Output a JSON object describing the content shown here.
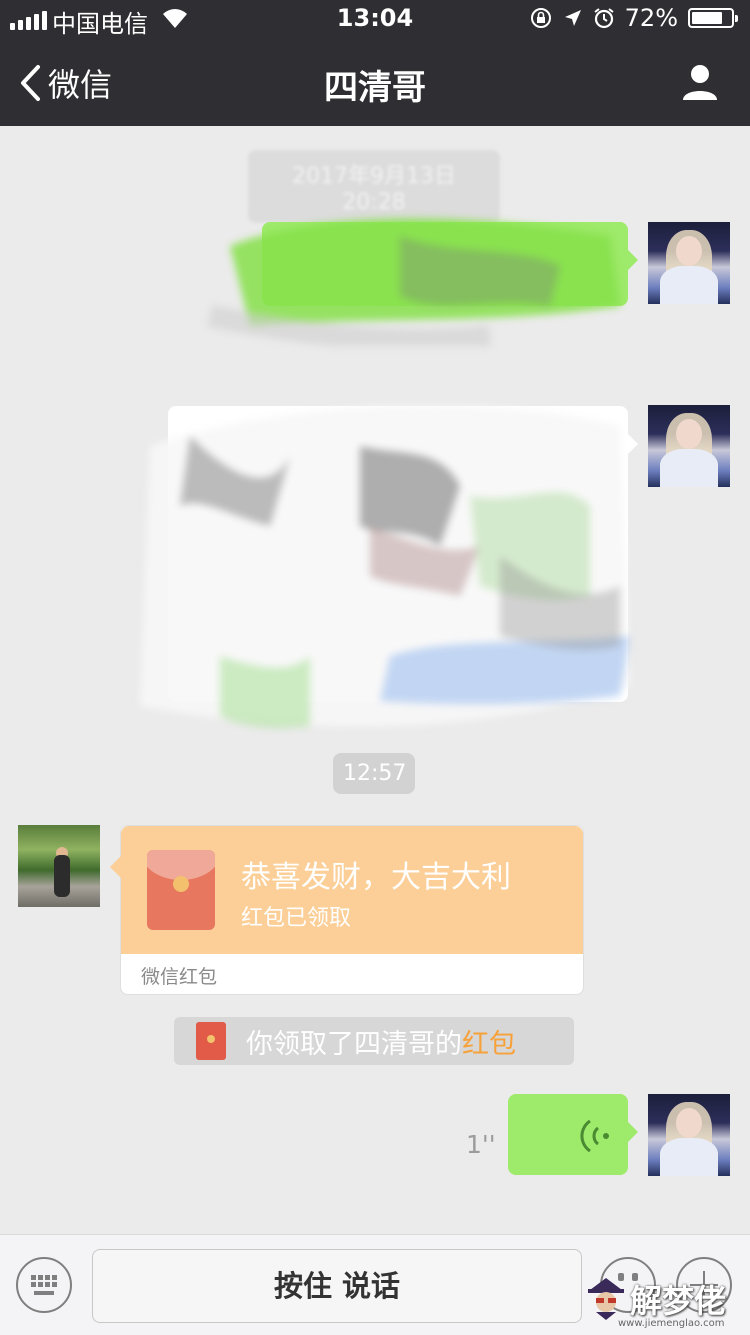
{
  "status_bar": {
    "carrier": "中国电信",
    "time": "13:04",
    "battery": "72%"
  },
  "nav": {
    "back_label": "微信",
    "title": "四清哥"
  },
  "chat": {
    "timestamp_top": "2017年9月13日 20:28",
    "timestamp_mid": "12:57",
    "red_packet": {
      "title": "恭喜发财，大吉大利",
      "status": "红包已领取",
      "footer": "微信红包"
    },
    "notice": {
      "text_prefix": "你领取了四清哥的",
      "text_highlight": "红包"
    },
    "voice_duration": "1''"
  },
  "input_bar": {
    "talk_label": "按住 说话"
  },
  "watermark": {
    "text": "解梦佬",
    "url": "www.jiemenglao.com"
  },
  "colors": {
    "nav_bg": "#2f2f33",
    "chat_bg": "#ebebeb",
    "bubble_green": "#9eea6a",
    "red_packet_bg": "#fbcf97",
    "highlight": "#f6a13a"
  }
}
